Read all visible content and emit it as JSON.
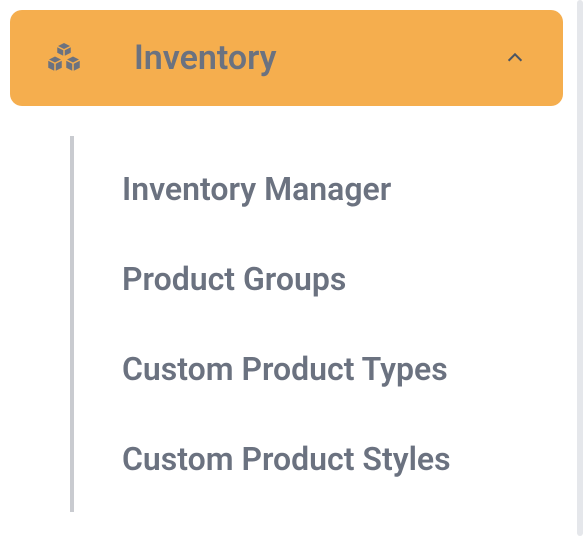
{
  "menu": {
    "label": "Inventory",
    "icon": "boxes-icon",
    "expanded": true
  },
  "submenu": {
    "items": [
      {
        "label": "Inventory Manager"
      },
      {
        "label": "Product Groups"
      },
      {
        "label": "Custom Product Types"
      },
      {
        "label": "Custom Product Styles"
      }
    ]
  }
}
